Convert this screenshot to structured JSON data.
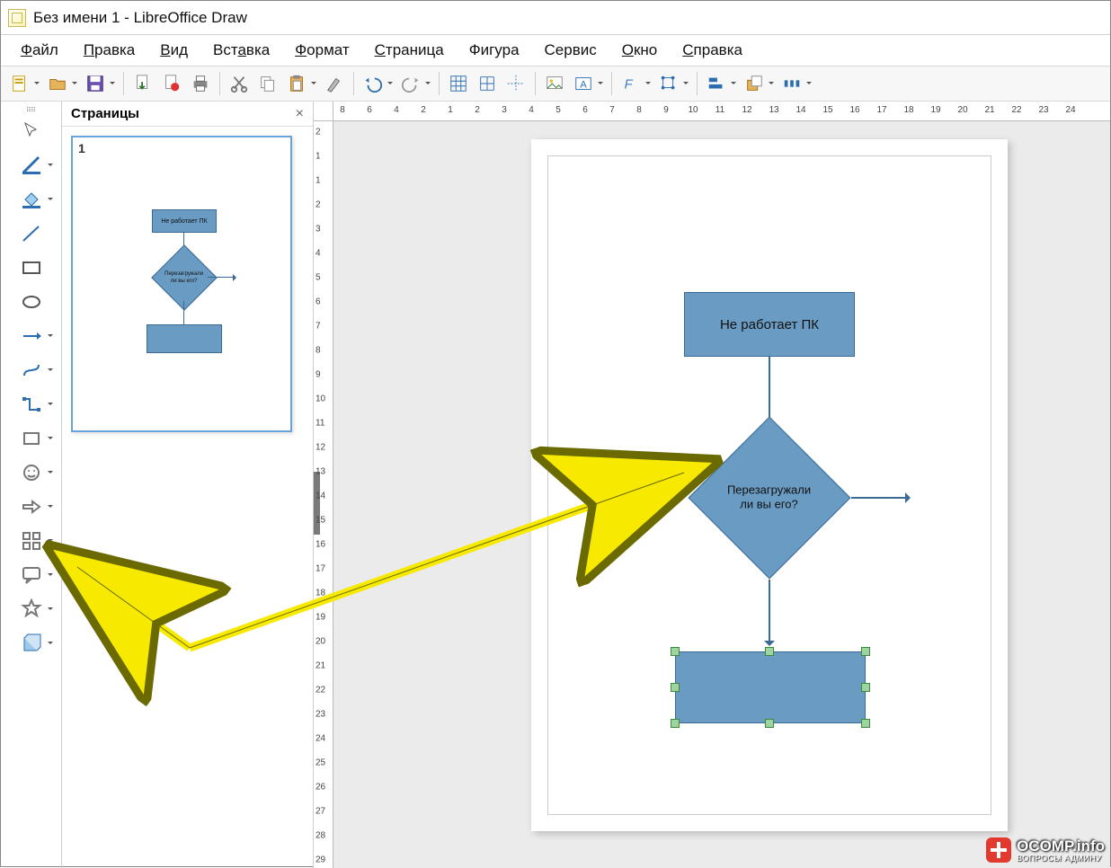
{
  "title": "Без имени 1 - LibreOffice Draw",
  "menu": [
    "Файл",
    "Правка",
    "Вид",
    "Вставка",
    "Формат",
    "Страница",
    "Фигура",
    "Сервис",
    "Окно",
    "Справка"
  ],
  "menu_underline": [
    0,
    0,
    0,
    4,
    0,
    0,
    -1,
    -1,
    0,
    0
  ],
  "pages_panel": {
    "title": "Страницы",
    "page_number": "1"
  },
  "flowchart": {
    "box1": "Не работает ПК",
    "decision": "Перезагружали\nли вы его?"
  },
  "thumb": {
    "box1": "Не работает ПК",
    "decision": "Перезагружали\nли вы его?"
  },
  "ruler_h": [
    "8",
    "6",
    "4",
    "2",
    "1",
    "2",
    "3",
    "4",
    "5",
    "6",
    "7",
    "8",
    "9",
    "10",
    "11",
    "12",
    "13",
    "14",
    "15",
    "16",
    "17",
    "18",
    "19",
    "20",
    "21",
    "22",
    "23",
    "24"
  ],
  "ruler_v": [
    "2",
    "1",
    "1",
    "2",
    "3",
    "4",
    "5",
    "6",
    "7",
    "8",
    "9",
    "10",
    "11",
    "12",
    "13",
    "14",
    "15",
    "16",
    "17",
    "18",
    "19",
    "20",
    "21",
    "22",
    "23",
    "24",
    "25",
    "26",
    "27",
    "28",
    "29"
  ],
  "watermark": {
    "brand": "OCOMP.info",
    "sub": "ВОПРОСЫ АДМИНУ"
  }
}
